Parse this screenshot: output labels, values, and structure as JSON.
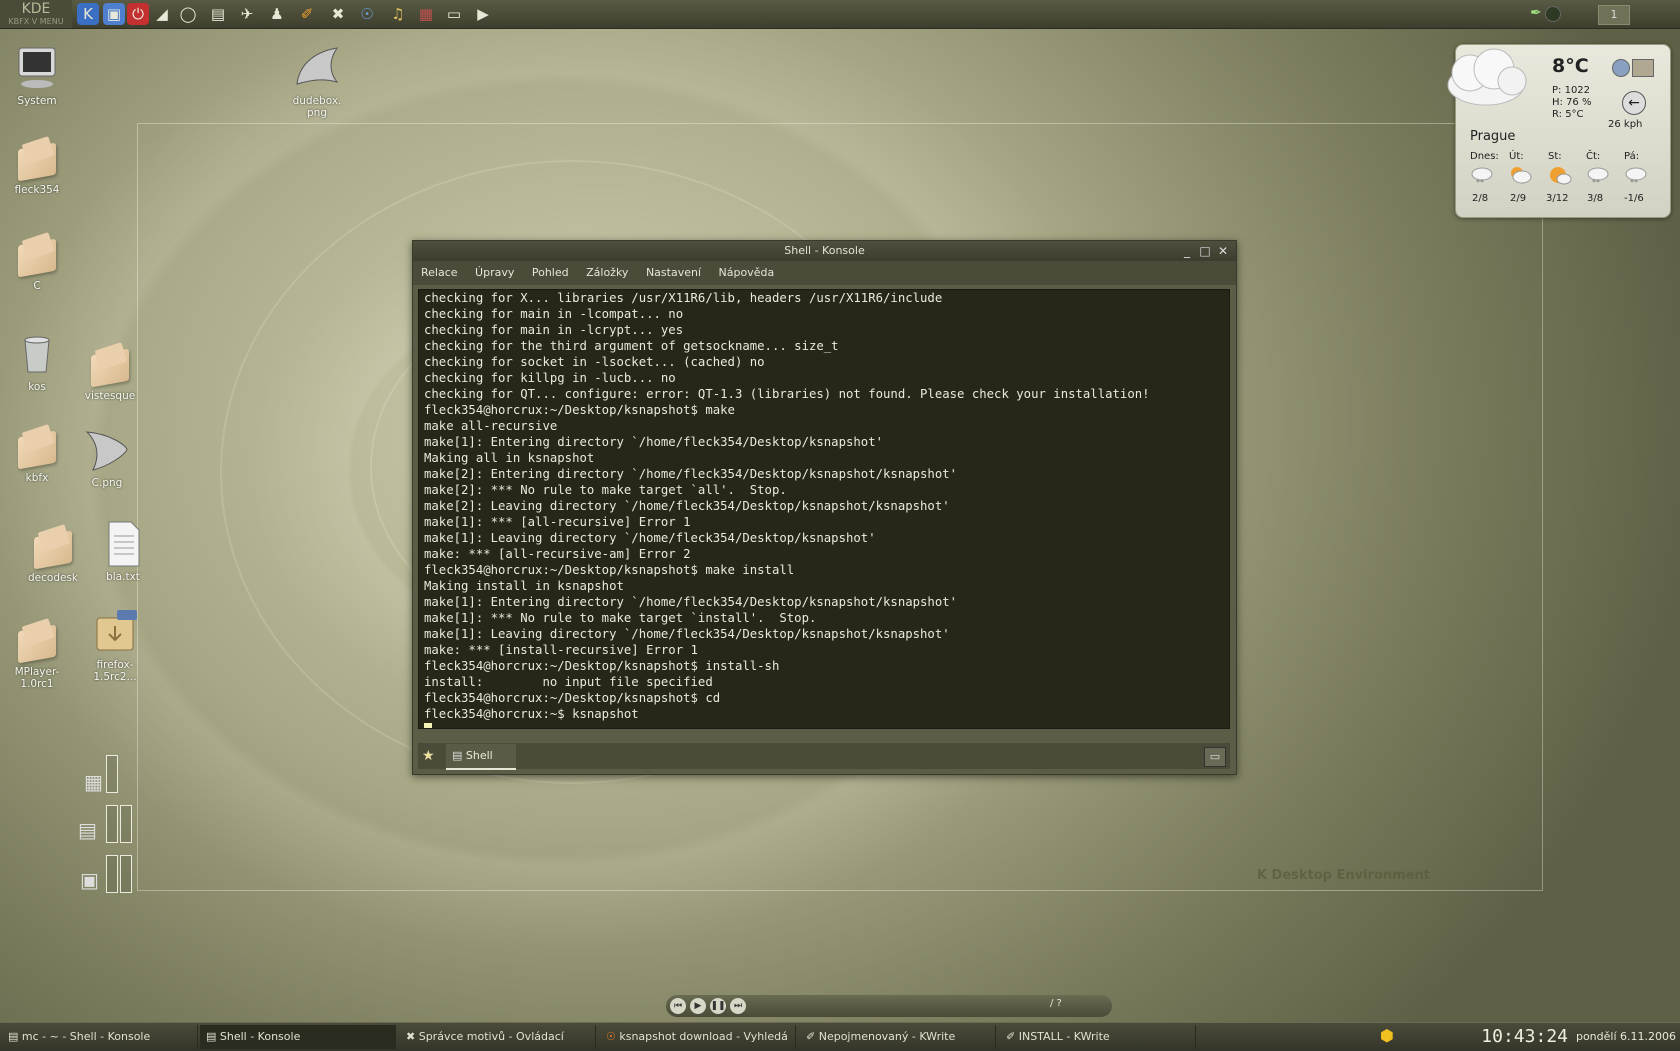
{
  "top_panel": {
    "logo_text": "KDE",
    "logo_sub": "KBFX V MENU",
    "launchers": [
      "kde-menu-icon",
      "screen-lock-icon",
      "logout-icon",
      "dudebox-icon",
      "globe-icon",
      "monitor-icon",
      "tux-icon",
      "penguin-icon",
      "paint-icon",
      "tools-icon",
      "firefox-icon",
      "music-icon",
      "film-icon",
      "display-icon",
      "arrow-icon"
    ],
    "pager_label": "1"
  },
  "desktop_icons": [
    {
      "label": "System",
      "kind": "computer"
    },
    {
      "label": "dudebox.\npng",
      "kind": "image"
    },
    {
      "label": "fleck354",
      "kind": "folder"
    },
    {
      "label": "C",
      "kind": "folder"
    },
    {
      "label": "kos",
      "kind": "trash"
    },
    {
      "label": "vistesque",
      "kind": "folder"
    },
    {
      "label": "kbfx",
      "kind": "folder"
    },
    {
      "label": "C.png",
      "kind": "image"
    },
    {
      "label": "decodesk",
      "kind": "folder"
    },
    {
      "label": "bla.txt",
      "kind": "text"
    },
    {
      "label": "MPlayer-\n1.0rc1",
      "kind": "folder"
    },
    {
      "label": "firefox-\n1.5rc2...",
      "kind": "archive"
    }
  ],
  "desktop_brand": "K Desktop Environment",
  "weather": {
    "temperature": "8°C",
    "pressure": "P: 1022",
    "humidity": "H: 76 %",
    "dew": "R: 5°C",
    "wind": "26 kph",
    "city": "Prague",
    "forecast": [
      {
        "day": "Dnes:",
        "temp": "2/8"
      },
      {
        "day": "Út:",
        "temp": "2/9"
      },
      {
        "day": "St:",
        "temp": "3/12"
      },
      {
        "day": "Čt:",
        "temp": "3/8"
      },
      {
        "day": "Pá:",
        "temp": "-1/6"
      }
    ]
  },
  "konsole": {
    "title": "Shell - Konsole",
    "menu": [
      "Relace",
      "Úpravy",
      "Pohled",
      "Záložky",
      "Nastavení",
      "Nápověda"
    ],
    "lines": [
      "checking for X... libraries /usr/X11R6/lib, headers /usr/X11R6/include",
      "checking for main in -lcompat... no",
      "checking for main in -lcrypt... yes",
      "checking for the third argument of getsockname... size_t",
      "checking for socket in -lsocket... (cached) no",
      "checking for killpg in -lucb... no",
      "checking for QT... configure: error: QT-1.3 (libraries) not found. Please check your installation!",
      "fleck354@horcrux:~/Desktop/ksnapshot$ make",
      "make all-recursive",
      "make[1]: Entering directory `/home/fleck354/Desktop/ksnapshot'",
      "Making all in ksnapshot",
      "make[2]: Entering directory `/home/fleck354/Desktop/ksnapshot/ksnapshot'",
      "make[2]: *** No rule to make target `all'.  Stop.",
      "make[2]: Leaving directory `/home/fleck354/Desktop/ksnapshot/ksnapshot'",
      "make[1]: *** [all-recursive] Error 1",
      "make[1]: Leaving directory `/home/fleck354/Desktop/ksnapshot'",
      "make: *** [all-recursive-am] Error 2",
      "fleck354@horcrux:~/Desktop/ksnapshot$ make install",
      "Making install in ksnapshot",
      "make[1]: Entering directory `/home/fleck354/Desktop/ksnapshot/ksnapshot'",
      "make[1]: *** No rule to make target `install'.  Stop.",
      "make[1]: Leaving directory `/home/fleck354/Desktop/ksnapshot/ksnapshot'",
      "make: *** [install-recursive] Error 1",
      "fleck354@horcrux:~/Desktop/ksnapshot$ install-sh",
      "install:        no input file specified",
      "fleck354@horcrux:~/Desktop/ksnapshot$ cd",
      "fleck354@horcrux:~$ ksnapshot"
    ],
    "tab_label": "Shell"
  },
  "player": {
    "position_text": "/ ?"
  },
  "taskbar": [
    {
      "label": "mc - ~ - Shell - Konsole",
      "active": false
    },
    {
      "label": "Shell - Konsole",
      "active": true
    },
    {
      "label": "Správce motivů - Ovládací",
      "active": false
    },
    {
      "label": "ksnapshot download - Vyhledá",
      "active": false
    },
    {
      "label": "Nepojmenovaný - KWrite",
      "active": false
    },
    {
      "label": "INSTALL - KWrite",
      "active": false
    }
  ],
  "clock": "10:43:24",
  "date": "pondělí 6.11.2006"
}
